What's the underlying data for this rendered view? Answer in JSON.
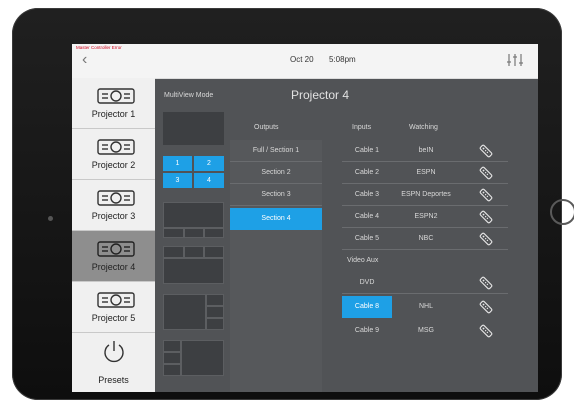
{
  "status": {
    "error_text": "Master Controller Error"
  },
  "header": {
    "date": "Oct 20",
    "time": "5:08pm"
  },
  "sidebar": {
    "items": [
      {
        "label": "Projector 1"
      },
      {
        "label": "Projector 2"
      },
      {
        "label": "Projector 3"
      },
      {
        "label": "Projector 4"
      },
      {
        "label": "Projector 5"
      }
    ],
    "active_index": 3,
    "presets_label": "Presets"
  },
  "multiview": {
    "label": "MultiView Mode",
    "selected_quad_numbers": [
      "1",
      "2",
      "3",
      "4"
    ]
  },
  "main": {
    "title": "Projector 4"
  },
  "outputs": {
    "header": "Outputs",
    "items": [
      "Full / Section 1",
      "Section 2",
      "Section 3",
      "Section 4"
    ],
    "selected_index": 3
  },
  "inputs": {
    "header_inputs": "Inputs",
    "header_watching": "Watching",
    "cable_rows": [
      {
        "input": "Cable 1",
        "watching": "beIN"
      },
      {
        "input": "Cable 2",
        "watching": "ESPN"
      },
      {
        "input": "Cable 3",
        "watching": "ESPN Deportes"
      },
      {
        "input": "Cable 4",
        "watching": "ESPN2"
      },
      {
        "input": "Cable 5",
        "watching": "NBC"
      }
    ],
    "aux_header": "Video Aux",
    "aux_rows": [
      {
        "input": "DVD",
        "watching": ""
      },
      {
        "input": "Cable 8",
        "watching": "NHL"
      },
      {
        "input": "Cable 9",
        "watching": "MSG"
      }
    ],
    "selected_input": "Cable 8"
  },
  "colors": {
    "accent": "#1ea0e6",
    "panel": "#515356",
    "error": "#d0021b"
  },
  "icons": [
    "back-chevron-icon",
    "mixer-sliders-icon",
    "projector-icon",
    "power-icon",
    "remote-icon"
  ]
}
